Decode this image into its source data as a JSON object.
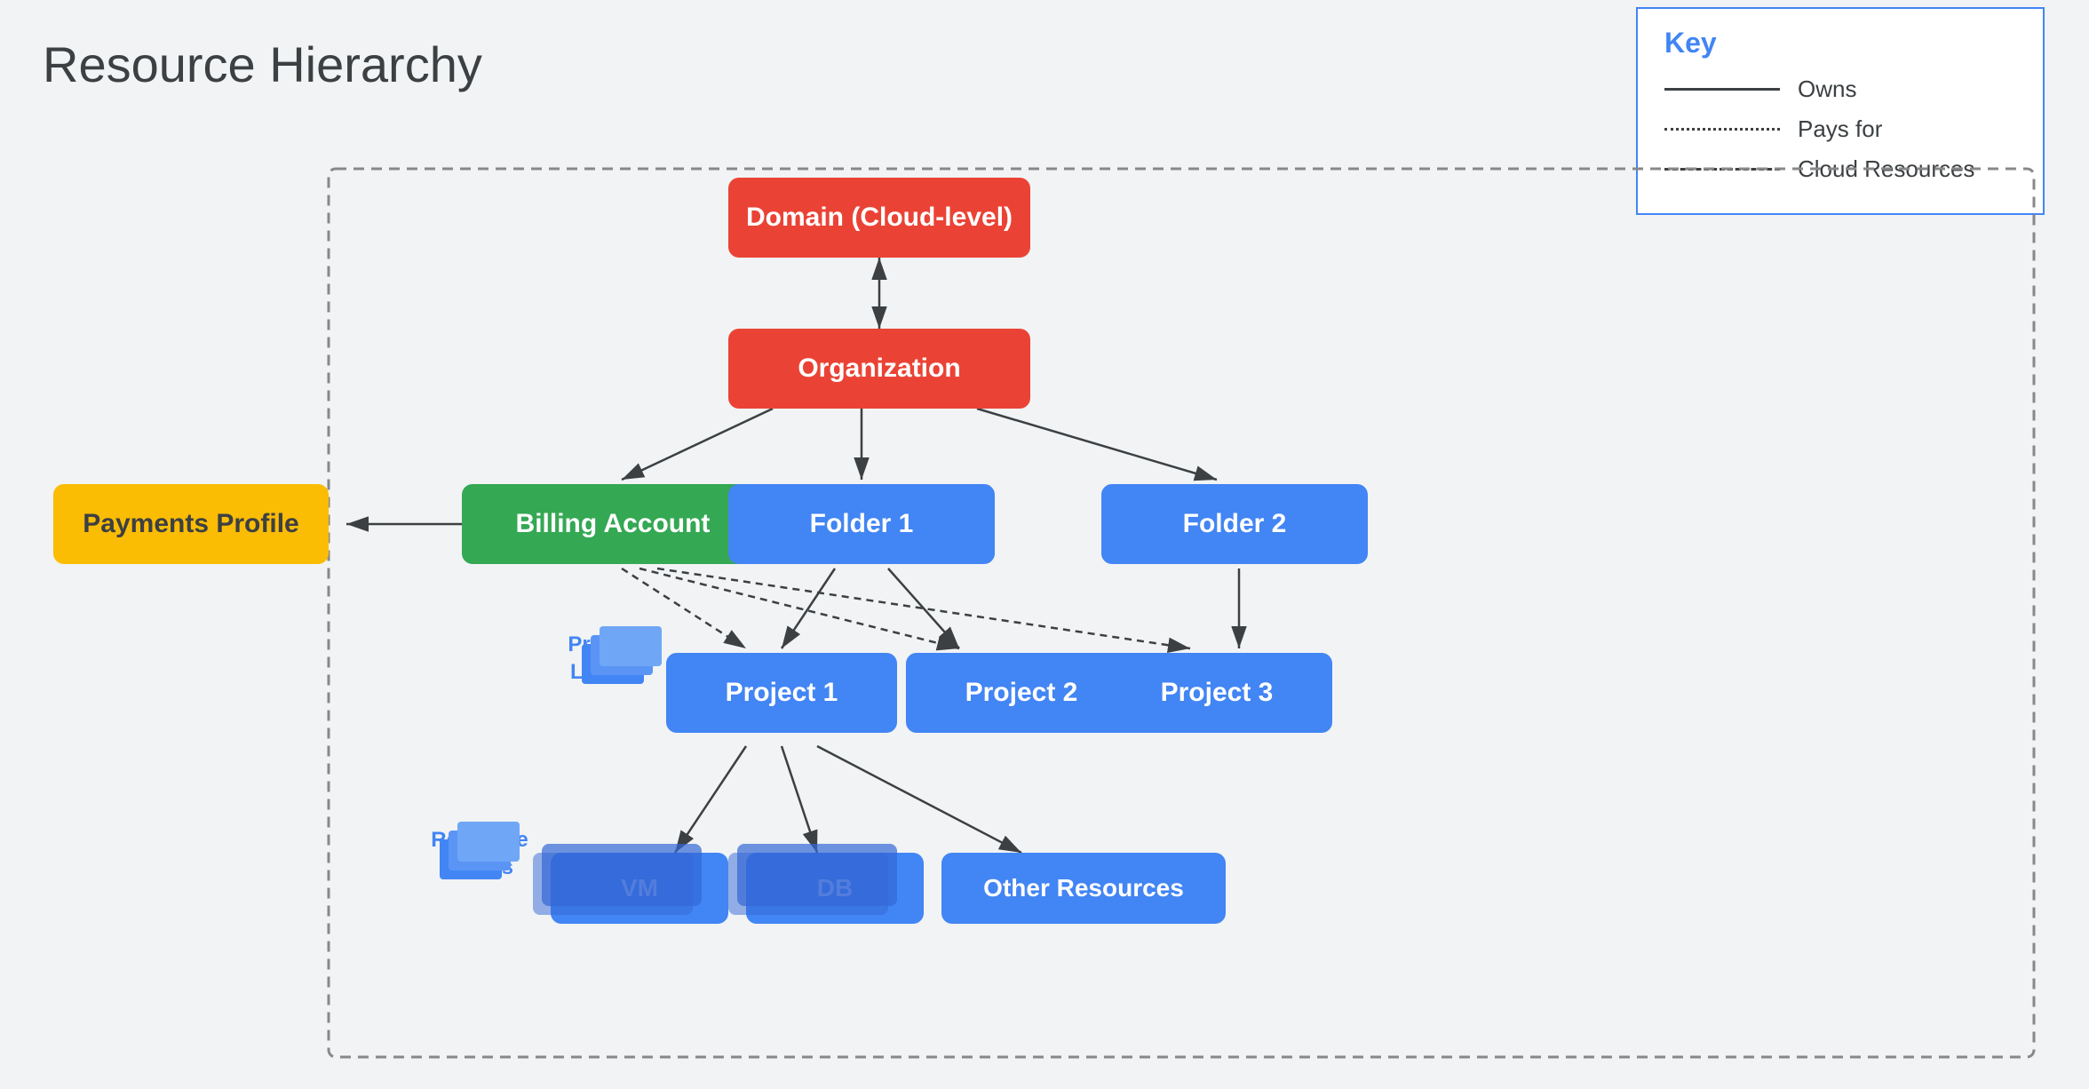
{
  "title": "Resource Hierarchy",
  "key": {
    "title": "Key",
    "items": [
      {
        "id": "owns",
        "line_type": "solid",
        "label": "Owns"
      },
      {
        "id": "pays_for",
        "line_type": "dotted",
        "label": "Pays for"
      },
      {
        "id": "cloud_resources",
        "line_type": "dashed",
        "label": "Cloud Resources"
      }
    ]
  },
  "nodes": {
    "domain": {
      "label": "Domain (Cloud-level)"
    },
    "organization": {
      "label": "Organization"
    },
    "billing_account": {
      "label": "Billing Account"
    },
    "payments_profile": {
      "label": "Payments Profile"
    },
    "folder1": {
      "label": "Folder 1"
    },
    "folder2": {
      "label": "Folder 2"
    },
    "project1": {
      "label": "Project 1"
    },
    "project2": {
      "label": "Project 2"
    },
    "project3": {
      "label": "Project 3"
    },
    "vm": {
      "label": "VM"
    },
    "db": {
      "label": "DB"
    },
    "other_resources": {
      "label": "Other Resources"
    }
  },
  "labels": {
    "project_labels": "Project\nLabels",
    "resource_labels": "Resource\nLabels"
  }
}
